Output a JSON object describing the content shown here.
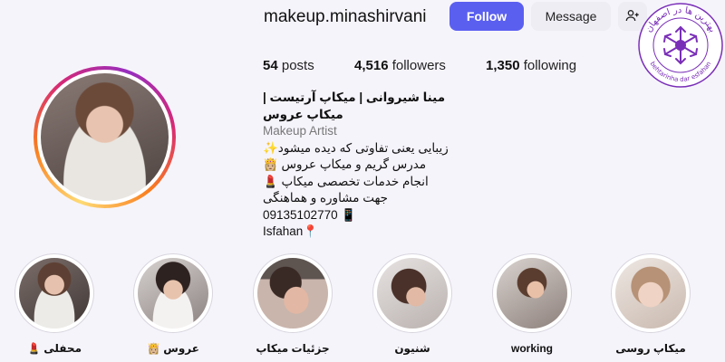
{
  "profile": {
    "username": "makeup.minashirvani",
    "follow_label": "Follow",
    "message_label": "Message",
    "stats": {
      "posts_count": "54",
      "posts_label": "posts",
      "followers_count": "4,516",
      "followers_label": "followers",
      "following_count": "1,350",
      "following_label": "following"
    },
    "bio": {
      "full_name": "مینا شیروانی | میکاپ آرتیست | میکاپ عروس",
      "category": "Makeup Artist",
      "lines": [
        "زیبایی یعنی تفاوتی که دیده میشود✨",
        "مدرس گریم و میکاپ عروس 👸🏼",
        "انجام خدمات تخصصی میکاپ 💄",
        "جهت مشاوره و هماهنگی",
        "09135102770 📱",
        "Isfahan📍"
      ]
    }
  },
  "stamp": {
    "text_top": "بهترین ها در اصفهان",
    "text_bottom": "behtarinha dar esfahan"
  },
  "highlights": [
    {
      "label": "میکاپ روسی"
    },
    {
      "label": "working"
    },
    {
      "label": "شنیون"
    },
    {
      "label": "جزئیات میکاپ"
    },
    {
      "label": "عروس 👸🏼"
    },
    {
      "label": "محفلی 💄"
    }
  ],
  "colors": {
    "follow_button": "#5b5ff0",
    "secondary_button": "#efedf4",
    "story_ring": "gradient",
    "stamp": "#7a2fb8"
  },
  "icons": {
    "add_user": "add-person-icon",
    "stamp": "snowflake-stamp-icon"
  }
}
